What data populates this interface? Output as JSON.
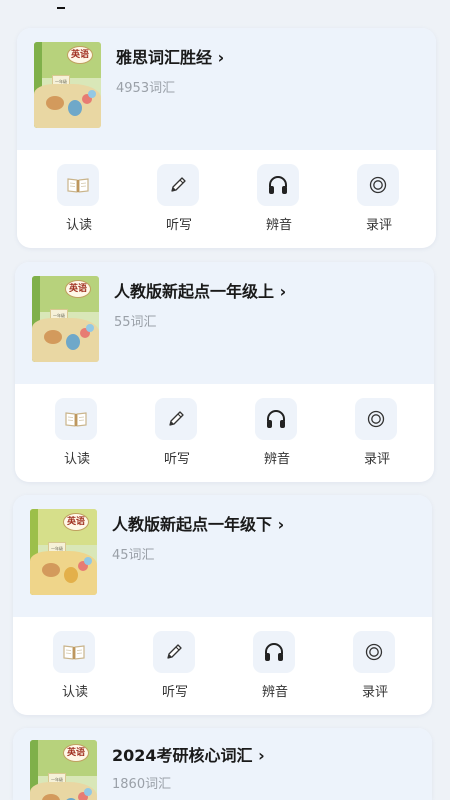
{
  "books": [
    {
      "title": "雅思词汇胜经",
      "count": "4953词汇",
      "cover_text": "英语",
      "cover_grade": "一年级"
    },
    {
      "title": "人教版新起点一年级上",
      "count": "55词汇",
      "cover_text": "英语",
      "cover_grade": "一年级"
    },
    {
      "title": "人教版新起点一年级下",
      "count": "45词汇",
      "cover_text": "英语",
      "cover_grade": "一年级"
    },
    {
      "title": "2024考研核心词汇",
      "count": "1860词汇",
      "cover_text": "英语",
      "cover_grade": "一年级"
    }
  ],
  "chevron": "›",
  "actions": [
    {
      "label": "认读",
      "icon": "book-icon"
    },
    {
      "label": "听写",
      "icon": "pencil-icon"
    },
    {
      "label": "辨音",
      "icon": "headphones-icon"
    },
    {
      "label": "录评",
      "icon": "record-icon"
    }
  ],
  "colors": {
    "background": "#eef2f7",
    "card_top": "#edf3fb",
    "card_bottom": "#ffffff",
    "title": "#1a1a1a",
    "count": "#9aa0a8"
  }
}
